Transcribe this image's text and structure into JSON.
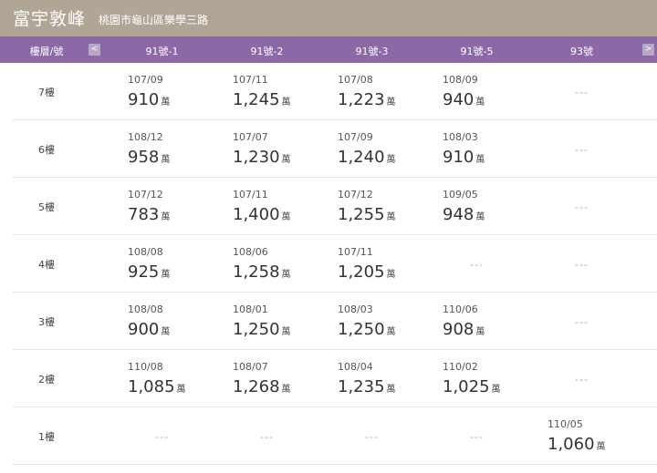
{
  "header": {
    "title": "富宇敦峰",
    "address": "桃園市龜山區樂學三路"
  },
  "columns": {
    "floor_label": "樓層/號",
    "prev": "<",
    "next": ">",
    "headers": [
      "91號-1",
      "91號-2",
      "91號-3",
      "91號-5",
      "93號"
    ]
  },
  "unit": "萬",
  "empty_mark": "---",
  "rows": [
    {
      "floor": "7樓",
      "cells": [
        {
          "date": "107/09",
          "price": "910"
        },
        {
          "date": "107/11",
          "price": "1,245"
        },
        {
          "date": "107/08",
          "price": "1,223"
        },
        {
          "date": "108/09",
          "price": "940"
        },
        null
      ]
    },
    {
      "floor": "6樓",
      "cells": [
        {
          "date": "108/12",
          "price": "958"
        },
        {
          "date": "107/07",
          "price": "1,230"
        },
        {
          "date": "107/09",
          "price": "1,240"
        },
        {
          "date": "108/03",
          "price": "910"
        },
        null
      ]
    },
    {
      "floor": "5樓",
      "cells": [
        {
          "date": "107/12",
          "price": "783"
        },
        {
          "date": "107/11",
          "price": "1,400"
        },
        {
          "date": "107/12",
          "price": "1,255"
        },
        {
          "date": "109/05",
          "price": "948"
        },
        null
      ]
    },
    {
      "floor": "4樓",
      "cells": [
        {
          "date": "108/08",
          "price": "925"
        },
        {
          "date": "108/06",
          "price": "1,258"
        },
        {
          "date": "107/11",
          "price": "1,205"
        },
        null,
        null
      ]
    },
    {
      "floor": "3樓",
      "cells": [
        {
          "date": "108/08",
          "price": "900"
        },
        {
          "date": "108/01",
          "price": "1,250"
        },
        {
          "date": "108/03",
          "price": "1,250"
        },
        {
          "date": "110/06",
          "price": "908"
        },
        null
      ]
    },
    {
      "floor": "2樓",
      "cells": [
        {
          "date": "110/08",
          "price": "1,085"
        },
        {
          "date": "108/07",
          "price": "1,268"
        },
        {
          "date": "108/04",
          "price": "1,235"
        },
        {
          "date": "110/02",
          "price": "1,025"
        },
        null
      ]
    },
    {
      "floor": "1樓",
      "cells": [
        null,
        null,
        null,
        null,
        {
          "date": "110/05",
          "price": "1,060"
        }
      ]
    }
  ]
}
